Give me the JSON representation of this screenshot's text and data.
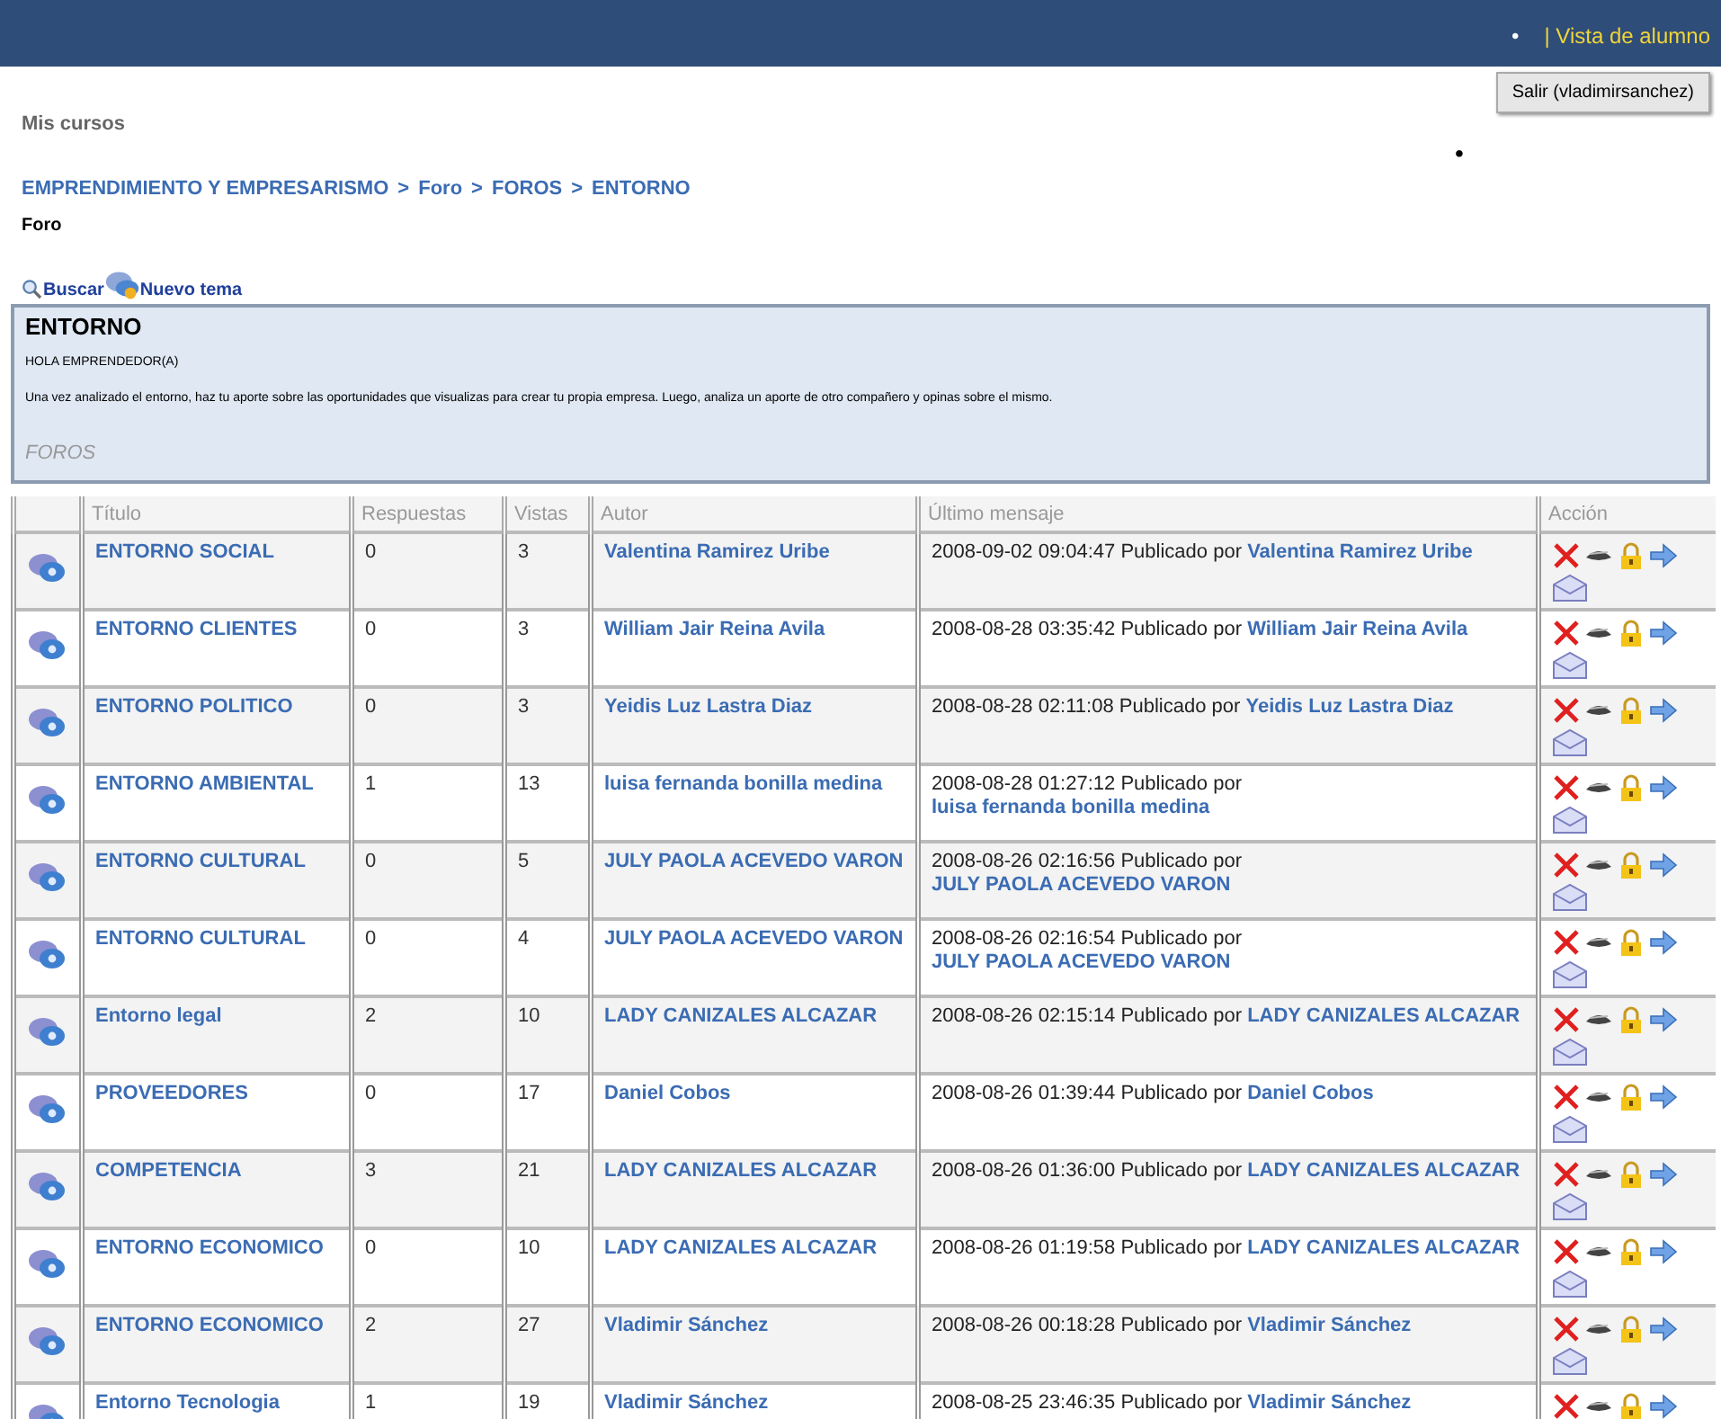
{
  "header": {
    "bullet": "•",
    "student_view_link": "| Vista de alumno"
  },
  "logout_button": "Salir (vladimirsanchez)",
  "side_bullet": "•",
  "my_courses": "Mis cursos",
  "breadcrumb": [
    "EMPRENDIMIENTO Y EMPRESARISMO",
    "Foro",
    "FOROS",
    "ENTORNO"
  ],
  "breadcrumb_separator": ">",
  "page_title": "Foro",
  "toolbar": [
    {
      "label": "Buscar",
      "kind": "search"
    },
    {
      "label": "Nuevo tema",
      "kind": "new"
    }
  ],
  "forum": {
    "title": "ENTORNO",
    "greeting": "HOLA EMPRENDEDOR(A)",
    "description": "Una vez analizado el entorno, haz tu aporte sobre las oportunidades que visualizas para crear tu propia empresa. Luego, analiza un aporte de otro compañero y opinas sobre el mismo.",
    "category": "FOROS"
  },
  "table": {
    "columns": [
      "Título",
      "Respuestas",
      "Vistas",
      "Autor",
      "Último mensaje",
      "Acción"
    ],
    "rows": [
      {
        "title": "ENTORNO SOCIAL",
        "replies": "0",
        "views": "3",
        "author": "Valentina Ramirez Uribe",
        "last_date": "2008-09-02 09:04:47",
        "posted_by": "Publicado por",
        "last_author": "Valentina Ramirez Uribe"
      },
      {
        "title": "ENTORNO CLIENTES",
        "replies": "0",
        "views": "3",
        "author": "William Jair Reina Avila",
        "last_date": "2008-08-28 03:35:42",
        "posted_by": "Publicado por",
        "last_author": "William Jair Reina Avila"
      },
      {
        "title": "ENTORNO POLITICO",
        "replies": "0",
        "views": "3",
        "author": "Yeidis Luz Lastra Diaz",
        "last_date": "2008-08-28 02:11:08",
        "posted_by": "Publicado por",
        "last_author": "Yeidis Luz Lastra Diaz"
      },
      {
        "title": "ENTORNO AMBIENTAL",
        "replies": "1",
        "views": "13",
        "author": "luisa fernanda bonilla medina",
        "last_date": "2008-08-28 01:27:12",
        "posted_by": "Publicado por",
        "last_author": "luisa fernanda bonilla medina"
      },
      {
        "title": "ENTORNO CULTURAL",
        "replies": "0",
        "views": "5",
        "author": "JULY PAOLA ACEVEDO VARON",
        "last_date": "2008-08-26 02:16:56",
        "posted_by": "Publicado por",
        "last_author": "JULY PAOLA ACEVEDO VARON"
      },
      {
        "title": "ENTORNO CULTURAL",
        "replies": "0",
        "views": "4",
        "author": "JULY PAOLA ACEVEDO VARON",
        "last_date": "2008-08-26 02:16:54",
        "posted_by": "Publicado por",
        "last_author": "JULY PAOLA ACEVEDO VARON"
      },
      {
        "title": "Entorno legal",
        "replies": "2",
        "views": "10",
        "author": "LADY CANIZALES ALCAZAR",
        "last_date": "2008-08-26 02:15:14",
        "posted_by": "Publicado por",
        "last_author": "LADY CANIZALES ALCAZAR"
      },
      {
        "title": "PROVEEDORES",
        "replies": "0",
        "views": "17",
        "author": "Daniel Cobos",
        "last_date": "2008-08-26 01:39:44",
        "posted_by": "Publicado por",
        "last_author": "Daniel Cobos"
      },
      {
        "title": "COMPETENCIA",
        "replies": "3",
        "views": "21",
        "author": "LADY CANIZALES ALCAZAR",
        "last_date": "2008-08-26 01:36:00",
        "posted_by": "Publicado por",
        "last_author": "LADY CANIZALES ALCAZAR"
      },
      {
        "title": "ENTORNO ECONOMICO",
        "replies": "0",
        "views": "10",
        "author": "LADY CANIZALES ALCAZAR",
        "last_date": "2008-08-26 01:19:58",
        "posted_by": "Publicado por",
        "last_author": "LADY CANIZALES ALCAZAR"
      },
      {
        "title": "ENTORNO ECONOMICO",
        "replies": "2",
        "views": "27",
        "author": "Vladimir Sánchez",
        "last_date": "2008-08-26 00:18:28",
        "posted_by": "Publicado por",
        "last_author": "Vladimir Sánchez"
      },
      {
        "title": "Entorno Tecnologia",
        "replies": "1",
        "views": "19",
        "author": "Vladimir Sánchez",
        "last_date": "2008-08-25 23:46:35",
        "posted_by": "Publicado por",
        "last_author": "Vladimir Sánchez"
      }
    ]
  }
}
